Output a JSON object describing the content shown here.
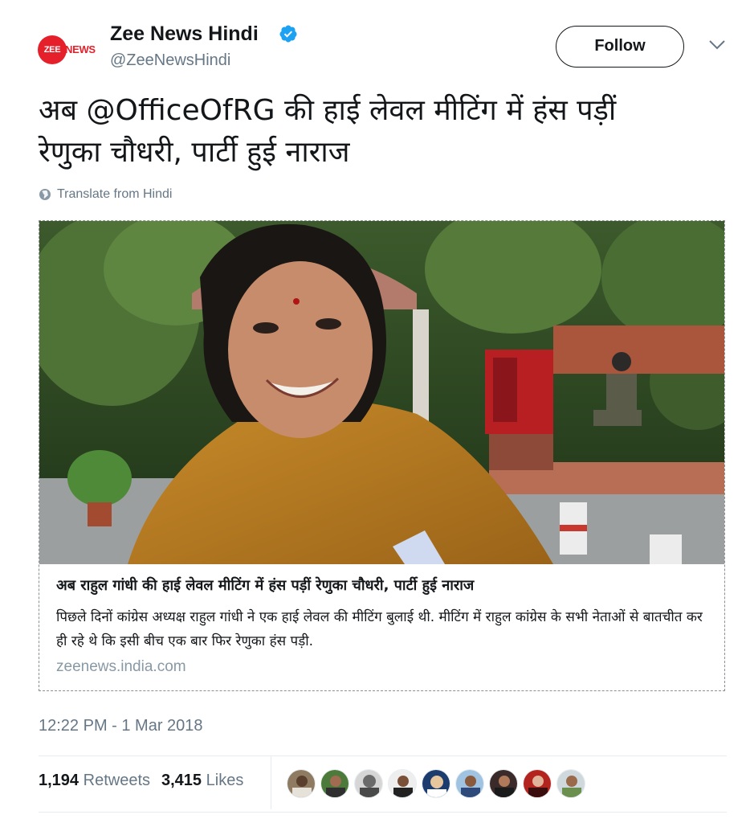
{
  "account": {
    "logo_text": "ZEE",
    "logo_text_2": "NEWS",
    "name": "Zee News Hindi",
    "handle": "@ZeeNewsHindi",
    "verified_icon": "verified-badge-icon"
  },
  "follow_label": "Follow",
  "tweet": {
    "prefix": "अब ",
    "mention": "@OfficeOfRG",
    "rest_line1": " की हाई लेवल मीटिंग में हंस पड़ीं",
    "line2": "रेणुका चौधरी, पार्टी हुई नाराज",
    "translate_label": "Translate from Hindi"
  },
  "card": {
    "title": "अब राहुल गांधी की हाई लेवल मीटिंग में हंस पड़ीं रेणुका चौधरी, पार्टी हुई नाराज",
    "description": "पिछले दिनों कांग्रेस अध्यक्ष राहुल गांधी ने एक हाई लेवल की मीटिंग बुलाई थी. मीटिंग में राहुल कांग्रेस के सभी नेताओं से बातचीत कर ही रहे थे कि इसी बीच एक बार फिर रेणुका हंस पड़ी.",
    "domain": "zeenews.india.com"
  },
  "timestamp": "12:22 PM - 1 Mar 2018",
  "stats": {
    "retweets_count": "1,194",
    "retweets_label": "Retweets",
    "likes_count": "3,415",
    "likes_label": "Likes"
  },
  "colors": {
    "brand_red": "#e5202b",
    "verified_blue": "#1da1f2",
    "secondary_text": "#657786"
  }
}
